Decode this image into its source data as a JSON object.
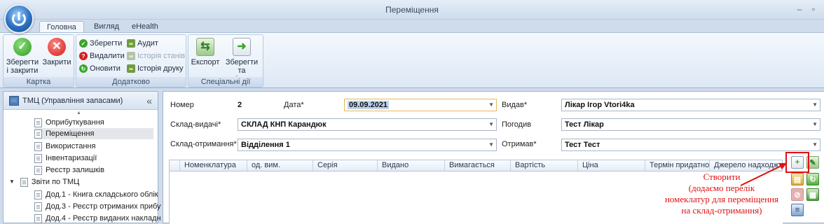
{
  "window": {
    "title": "Переміщення"
  },
  "ribbon_tabs": [
    {
      "label": "Головна",
      "active": true
    },
    {
      "label": "Вигляд",
      "active": false
    },
    {
      "label": "eHealth",
      "active": false
    }
  ],
  "ribbon": {
    "card_group": {
      "label": "Картка",
      "save_close": "Зберегти і закрити",
      "close": "Закрити"
    },
    "extra_group": {
      "label": "Додатково",
      "save": "Зберегти",
      "delete": "Видалити",
      "refresh": "Оновити",
      "audit": "Аудит",
      "state_history": "Історія станів",
      "print_history": "Історія друку"
    },
    "special_group": {
      "label": "Спеціальні дії",
      "export": "Експорт",
      "save_copy": "Зберегти та копіювати"
    }
  },
  "left_panel": {
    "title": "ТМЦ (Управління запасами)",
    "collapse_icon": "«",
    "items": [
      {
        "label": "Оприбуткування"
      },
      {
        "label": "Переміщення",
        "selected": true
      },
      {
        "label": "Використання"
      },
      {
        "label": "Інвентаризації"
      },
      {
        "label": "Реєстр залишків"
      }
    ],
    "section": "Звіти по ТМЦ",
    "reports": [
      {
        "label": "Дод.1 - Книга складського облік"
      },
      {
        "label": "Дод.3 - Реєстр отриманих прибу"
      },
      {
        "label": "Дод.4 - Реєстр виданих накладн"
      }
    ]
  },
  "form": {
    "number_label": "Номер",
    "number_value": "2",
    "date_label": "Дата*",
    "date_value": "09.09.2021",
    "issued_label": "Видав*",
    "issued_value": "Лікар Ігор Vtori4ka",
    "from_wh_label": "Склад-видачі*",
    "from_wh_value": "СКЛАД КНП Карандюк",
    "approved_label": "Погодив",
    "approved_value": "Тест Лікар",
    "to_wh_label": "Склад-отримання*",
    "to_wh_value": "Відділення 1",
    "received_label": "Отримав*",
    "received_value": "Тест Тест"
  },
  "grid_columns": [
    "Номенклатура",
    "од. вим.",
    "Серія",
    "Видано",
    "Вимагається",
    "Вартість",
    "Ціна",
    "Термін придатнос",
    "Джерело надходж"
  ],
  "annotation": {
    "text_line1": "Створити",
    "text_line2": "(додаємо перелік",
    "text_line3": "номеклатур для переміщення",
    "text_line4": "на склад-отримання)",
    "color": "#e01010"
  }
}
